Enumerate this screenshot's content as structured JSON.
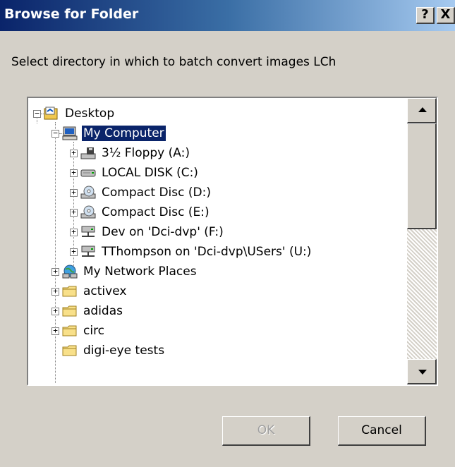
{
  "dialog": {
    "title": "Browse for Folder",
    "help_label": "?",
    "close_label": "X",
    "prompt": "Select directory in which to batch convert images LCh",
    "ok_label": "OK",
    "cancel_label": "Cancel",
    "ok_enabled": false
  },
  "tree": {
    "items": [
      {
        "label": "Desktop",
        "icon": "desktop-icon",
        "expander": "−"
      },
      {
        "label": "My Computer",
        "icon": "computer-icon",
        "expander": "−",
        "selected": true
      },
      {
        "label": "3½ Floppy (A:)",
        "icon": "floppy-drive-icon",
        "expander": "+"
      },
      {
        "label": "LOCAL DISK (C:)",
        "icon": "hard-disk-icon",
        "expander": "+"
      },
      {
        "label": "Compact Disc (D:)",
        "icon": "cd-drive-icon",
        "expander": "+"
      },
      {
        "label": "Compact Disc (E:)",
        "icon": "cd-drive-icon",
        "expander": "+"
      },
      {
        "label": "Dev on 'Dci-dvp' (F:)",
        "icon": "network-drive-icon",
        "expander": "+"
      },
      {
        "label": "TThompson on 'Dci-dvp\\USers' (U:)",
        "icon": "network-drive-icon",
        "expander": "+"
      },
      {
        "label": "My Network Places",
        "icon": "network-places-icon",
        "expander": "+"
      },
      {
        "label": "activex",
        "icon": "folder-icon",
        "expander": "+"
      },
      {
        "label": "adidas",
        "icon": "folder-icon",
        "expander": "+"
      },
      {
        "label": "circ",
        "icon": "folder-icon",
        "expander": "+"
      },
      {
        "label": "digi-eye tests",
        "icon": "folder-icon",
        "expander": ""
      }
    ]
  },
  "colors": {
    "title_bar_start": "#0a246a",
    "title_bar_end": "#a6caf0",
    "selection": "#0a246a",
    "face": "#d4d0c8"
  }
}
